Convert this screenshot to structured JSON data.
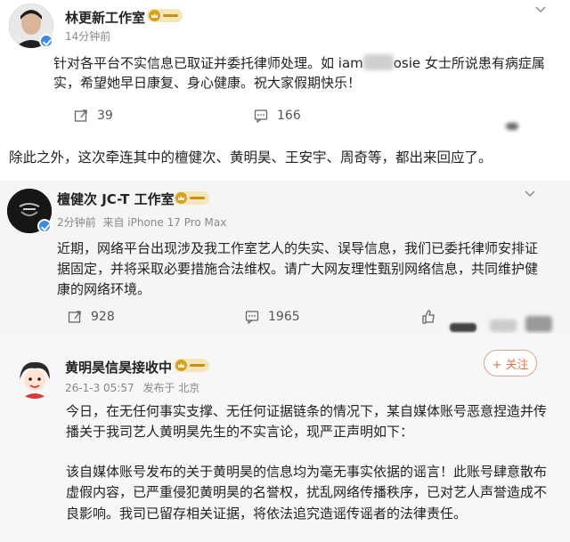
{
  "post1": {
    "name": "林更新工作室",
    "time": "14分钟前",
    "text_line1": "针对各平台不实信息已取证并委托律师处理。如 iam",
    "text_line1_tail": "osie 女士所说患有病症属",
    "text_line2": "实，希望她早日康复、身心健康。祝大家假期快乐！",
    "repost_count": "39",
    "comment_count": "166"
  },
  "narration": "除此之外，这次牵连其中的檀健次、黄明昊、王安宇、周奇等，都出来回应了。",
  "post2": {
    "name": "檀健次 JC-T 工作室",
    "time": "2分钟前",
    "source": "来自 iPhone 17 Pro Max",
    "text_line1": "近期，网络平台出现涉及我工作室艺人的失实、误导信息，我们已委托律师安排证",
    "text_line2": "据固定，并将采取必要措施合法维权。请广大网友理性甄别网络信息，共同维护健",
    "text_line3": "康的网络环境。",
    "repost_count": "928",
    "comment_count": "1965"
  },
  "post3": {
    "name": "黄明昊信昊接收中",
    "time": "26-1-3 05:57",
    "location": "发布于 北京",
    "follow_label": "+ 关注",
    "para1_line1": "今日，在无任何事实支撑、无任何证据链条的情况下，某自媒体账号恶意捏造并传",
    "para1_line2": "播关于我司艺人黄明昊先生的不实言论，现严正声明如下：",
    "para2_line1": "该自媒体账号发布的关于黄明昊的信息均为毫无事实依据的谣言！此账号肆意散布",
    "para2_line2": "虚假内容，已严重侵犯黄明昊的名誉权，扰乱网络传播秩序，已对艺人声誉造成不",
    "para2_line3": "良影响。我司已留存相关证据，将依法追究造谣传谣者的法律责任。"
  },
  "colors": {
    "verified_blue": "#3b8ae6",
    "follow_orange": "#e0754a",
    "meta_grey": "#888888"
  }
}
